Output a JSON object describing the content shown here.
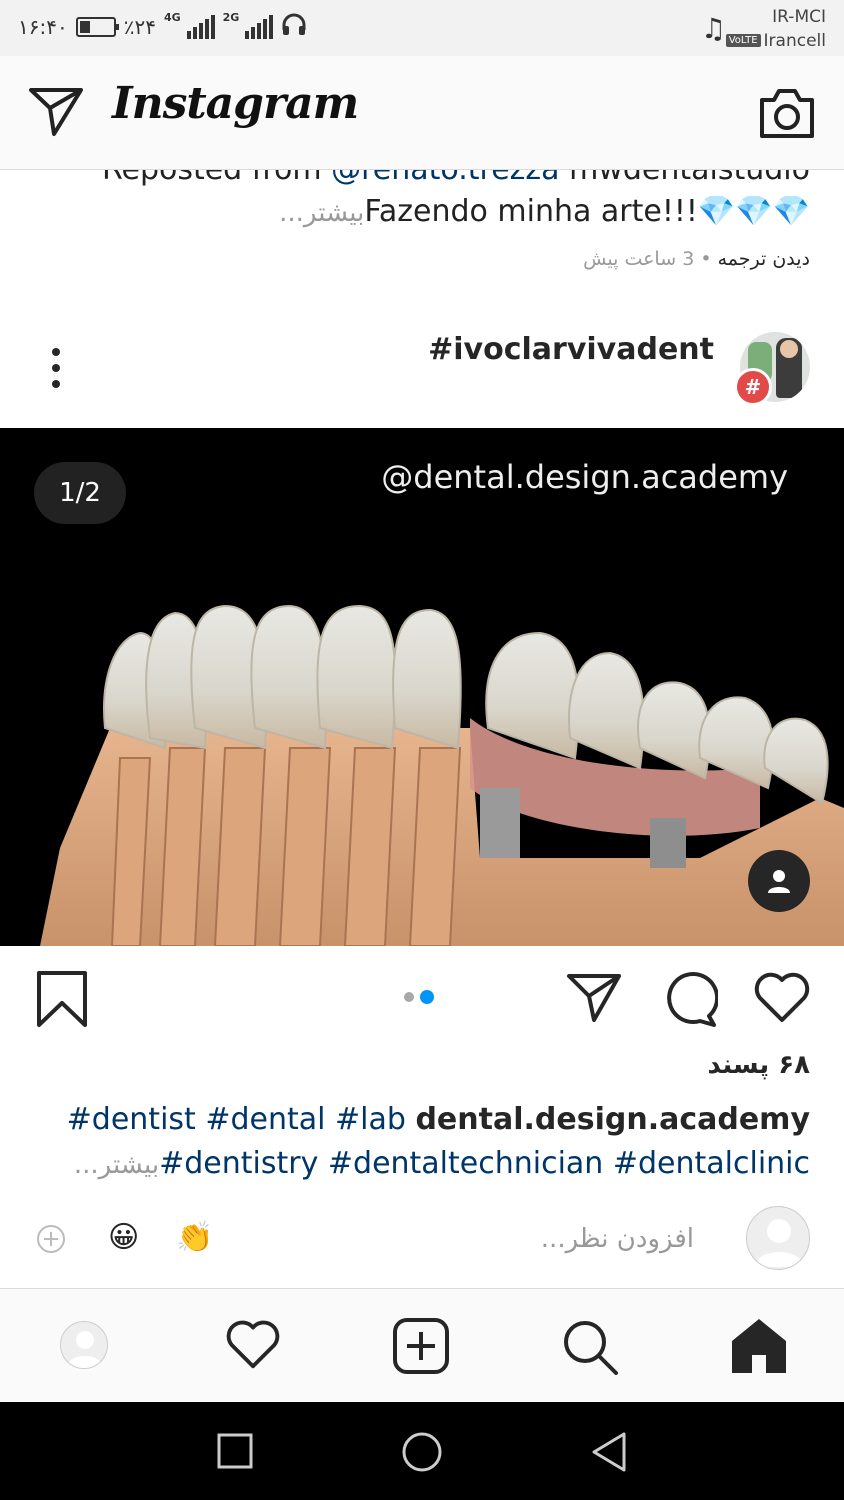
{
  "status_bar": {
    "time": "۱۶:۴۰",
    "battery": "٪۲۴",
    "net1": "4G",
    "net2": "2G",
    "carrier1": "IR-MCI",
    "carrier2": "Irancell",
    "volte": "VoLTE"
  },
  "header": {
    "logo": "Instagram",
    "icons": {
      "direct": "direct-message-icon",
      "camera": "camera-icon"
    }
  },
  "previous_post": {
    "line1_prefix": "Reposted from ",
    "line1_link": "@renato.trezza",
    "line1_suffix": " mwdentalstudio",
    "line2_text": "Fazendo minha arte!!!💎💎💎",
    "line2_more": "...بیشتر",
    "time_ago": "3 ساعت پیش",
    "separator": "•",
    "see_translation": "دیدن ترجمه"
  },
  "post": {
    "username": "#ivoclarvivadent",
    "badge": "#",
    "media_counter": "1/2",
    "watermark": "@dental.design.academy",
    "media_index": 2,
    "media_count": 2,
    "likes": "۶۸ پسند",
    "caption": {
      "user": "dental.design.academy",
      "tags_line1": "#dentist #dental #lab",
      "tags_line2": "#dentistry #dentaltechnician #dentalclinic",
      "more": "...بیشتر"
    }
  },
  "comment": {
    "placeholder": "افزودن نظر...",
    "emojis": [
      "😀",
      "👏"
    ]
  },
  "bottom_nav": [
    "profile-icon",
    "activity-heart-icon",
    "new-post-icon",
    "search-icon",
    "home-icon"
  ],
  "android_nav": [
    "recents-icon",
    "home-circle-icon",
    "back-icon"
  ],
  "colors": {
    "link": "#003569",
    "accent": "#0095f6",
    "muted": "#999999"
  }
}
